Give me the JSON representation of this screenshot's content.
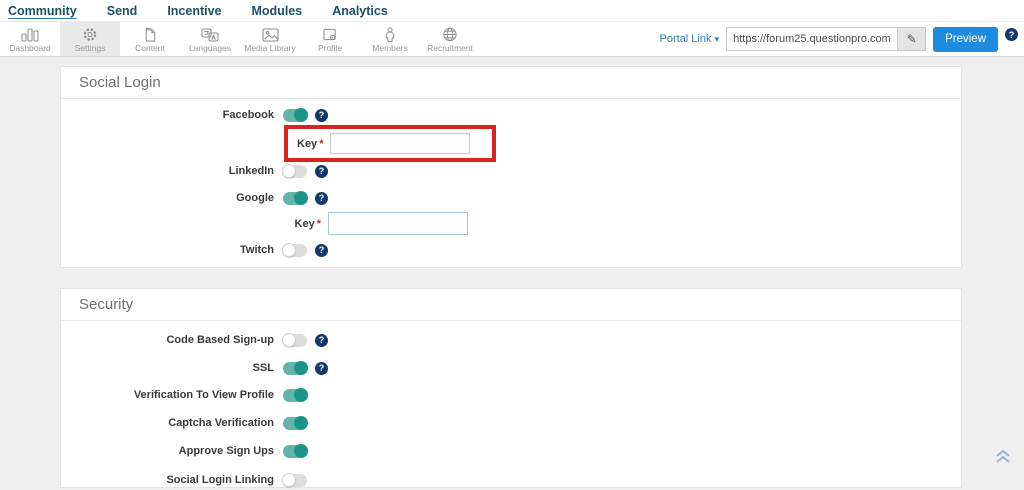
{
  "nav": {
    "items": [
      {
        "label": "Community",
        "active": true
      },
      {
        "label": "Send",
        "active": false
      },
      {
        "label": "Incentive",
        "active": false
      },
      {
        "label": "Modules",
        "active": false
      },
      {
        "label": "Analytics",
        "active": false
      }
    ]
  },
  "toolbar": {
    "items": [
      {
        "label": "Dashboard",
        "icon": "bar-chart-icon",
        "active": false
      },
      {
        "label": "Settings",
        "icon": "gear-icon",
        "active": true
      },
      {
        "label": "Content",
        "icon": "document-icon",
        "active": false
      },
      {
        "label": "Languages",
        "icon": "translate-icon",
        "active": false
      },
      {
        "label": "Media Library",
        "icon": "image-icon",
        "active": false
      },
      {
        "label": "Profile",
        "icon": "profile-card-icon",
        "active": false
      },
      {
        "label": "Members",
        "icon": "person-icon",
        "active": false
      },
      {
        "label": "Recruitment",
        "icon": "globe-icon",
        "active": false
      }
    ],
    "portal_link_label": "Portal Link",
    "portal_caret": "▾",
    "portal_url": "https://forum25.questionpro.com",
    "pencil_icon": "✎",
    "preview_label": "Preview",
    "help_glyph": "?"
  },
  "social_login": {
    "title": "Social Login",
    "rows": [
      {
        "label": "Facebook",
        "state": "on",
        "help": true
      },
      {
        "label": "LinkedIn",
        "state": "off",
        "help": true
      },
      {
        "label": "Google",
        "state": "on",
        "help": true
      },
      {
        "label": "Twitch",
        "state": "off",
        "help": true
      }
    ],
    "facebook_key": {
      "label": "Key",
      "required": "*",
      "value": "",
      "highlighted": true
    },
    "google_key": {
      "label": "Key",
      "required": "*",
      "value": ""
    }
  },
  "security": {
    "title": "Security",
    "rows": [
      {
        "label": "Code Based Sign-up",
        "state": "off",
        "help": true
      },
      {
        "label": "SSL",
        "state": "on",
        "help": true
      },
      {
        "label": "Verification To View Profile",
        "state": "on",
        "help": false
      },
      {
        "label": "Captcha Verification",
        "state": "on",
        "help": false
      },
      {
        "label": "Approve Sign Ups",
        "state": "on",
        "help": false
      },
      {
        "label": "Social Login Linking",
        "state": "off",
        "help": false,
        "clipped": true
      }
    ]
  },
  "misc": {
    "help_glyph": "?"
  },
  "colors": {
    "toggle_on_knob": "#1d9488",
    "toggle_on_track": "#63b5aa",
    "highlight_red": "#d92320",
    "preview_blue": "#1d8ce0",
    "help_navy": "#14386e",
    "nav_text": "#1c4f67"
  }
}
